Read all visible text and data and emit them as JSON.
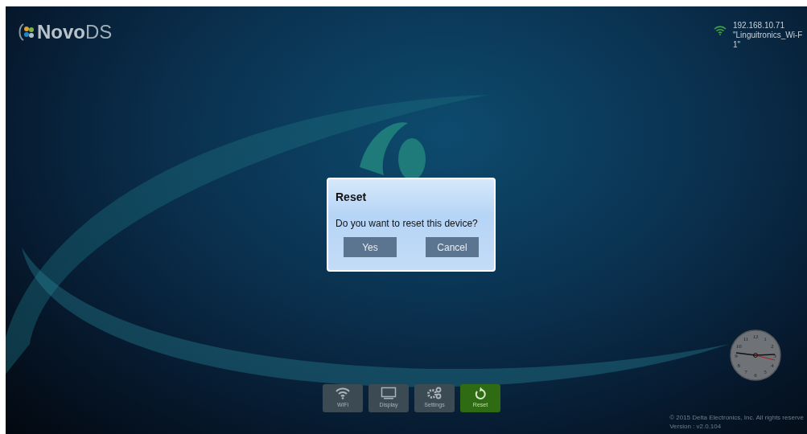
{
  "logo": {
    "brand_bold": "Novo",
    "brand_light": "DS"
  },
  "network": {
    "ip": "192.168.10.71",
    "ssid": "\"Linguitronics_Wi-F",
    "ssid_rest": "1\""
  },
  "dialog": {
    "title": "Reset",
    "message": "Do you want to reset this device?",
    "buttons": [
      "Yes",
      "Cancel"
    ]
  },
  "toolbar": [
    {
      "label": "WiFi",
      "kind": "wifi",
      "selected": false
    },
    {
      "label": "Display",
      "kind": "display",
      "selected": false
    },
    {
      "label": "Settings",
      "kind": "settings",
      "selected": false
    },
    {
      "label": "Reset",
      "kind": "reset",
      "selected": true
    }
  ],
  "clock": {
    "numbers": [
      "12",
      "1",
      "2",
      "3",
      "4",
      "5",
      "6",
      "7",
      "8",
      "9",
      "10",
      "11"
    ]
  },
  "footer": {
    "copyright": "© 2015 Delta Electronics, Inc. All rights reserve",
    "version": "Version : v2.0.104"
  }
}
